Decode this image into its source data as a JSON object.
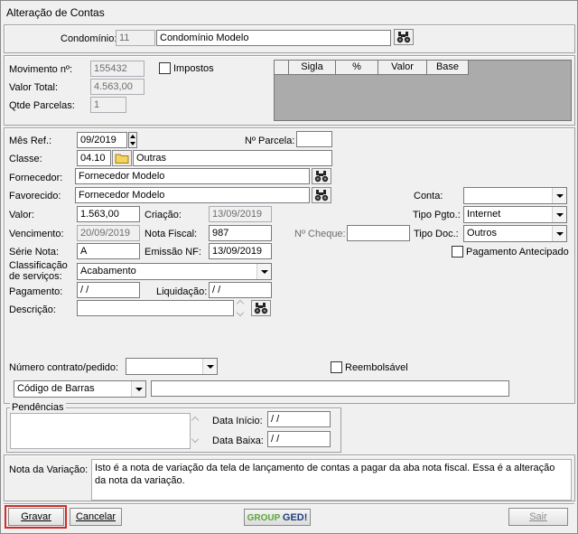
{
  "window": {
    "title": "Alteração de Contas"
  },
  "condominio": {
    "label": "Condomínio:",
    "code": "11",
    "name": "Condomínio Modelo"
  },
  "movimento": {
    "label_num": "Movimento nº:",
    "num": "155432",
    "label_total": "Valor Total:",
    "total": "4.563,00",
    "label_parc": "Qtde Parcelas:",
    "parc": "1",
    "impostos_label": "Impostos"
  },
  "impostos_grid": {
    "columns": [
      "Sigla",
      "%",
      "Valor",
      "Base"
    ]
  },
  "form": {
    "mes_ref_label": "Mês Ref.:",
    "mes_ref": "09/2019",
    "nparcela_label": "Nº Parcela:",
    "nparcela": "",
    "classe_label": "Classe:",
    "classe_code": "04.10",
    "classe_name": "Outras",
    "fornecedor_label": "Fornecedor:",
    "fornecedor": "Fornecedor Modelo",
    "favorecido_label": "Favorecido:",
    "favorecido": "Fornecedor Modelo",
    "conta_label": "Conta:",
    "conta": "",
    "valor_label": "Valor:",
    "valor": "1.563,00",
    "criacao_label": "Criação:",
    "criacao": "13/09/2019",
    "tipo_pgto_label": "Tipo Pgto.:",
    "tipo_pgto": "Internet",
    "vencimento_label": "Vencimento:",
    "vencimento": "20/09/2019",
    "nota_fiscal_label": "Nota Fiscal:",
    "nota_fiscal": "987",
    "ncheque_label": "Nº Cheque:",
    "ncheque": "",
    "tipo_doc_label": "Tipo Doc.:",
    "tipo_doc": "Outros",
    "serie_label": "Série Nota:",
    "serie": "A",
    "emissao_label": "Emissão NF:",
    "emissao": "13/09/2019",
    "pag_antecipado_label": "Pagamento Antecipado",
    "class_serv_label1": "Classificação",
    "class_serv_label2": "de serviços:",
    "class_serv": "Acabamento",
    "pagamento_label": "Pagamento:",
    "pagamento": " / /",
    "liquidacao_label": "Liquidação:",
    "liquidacao": " / /",
    "descricao_label": "Descrição:",
    "descricao": "",
    "contrato_label": "Número contrato/pedido:",
    "contrato": "",
    "reembolsavel_label": "Reembolsável",
    "barcode_type": "Código de Barras",
    "barcode": ""
  },
  "pendencias": {
    "legend": "Pendências",
    "data_inicio_label": "Data Início:",
    "data_inicio": " / /",
    "data_baixa_label": "Data Baixa:",
    "data_baixa": " / /"
  },
  "nota": {
    "label": "Nota da Variação:",
    "text": "Isto é a nota de variação da tela de lançamento de contas a pagar da aba nota fiscal. Essa é a alteração da nota da variação."
  },
  "buttons": {
    "gravar": "Gravar",
    "cancelar": "Cancelar",
    "sair": "Sair"
  },
  "logo": {
    "part1": "GROUP",
    "part2": "GED!"
  }
}
